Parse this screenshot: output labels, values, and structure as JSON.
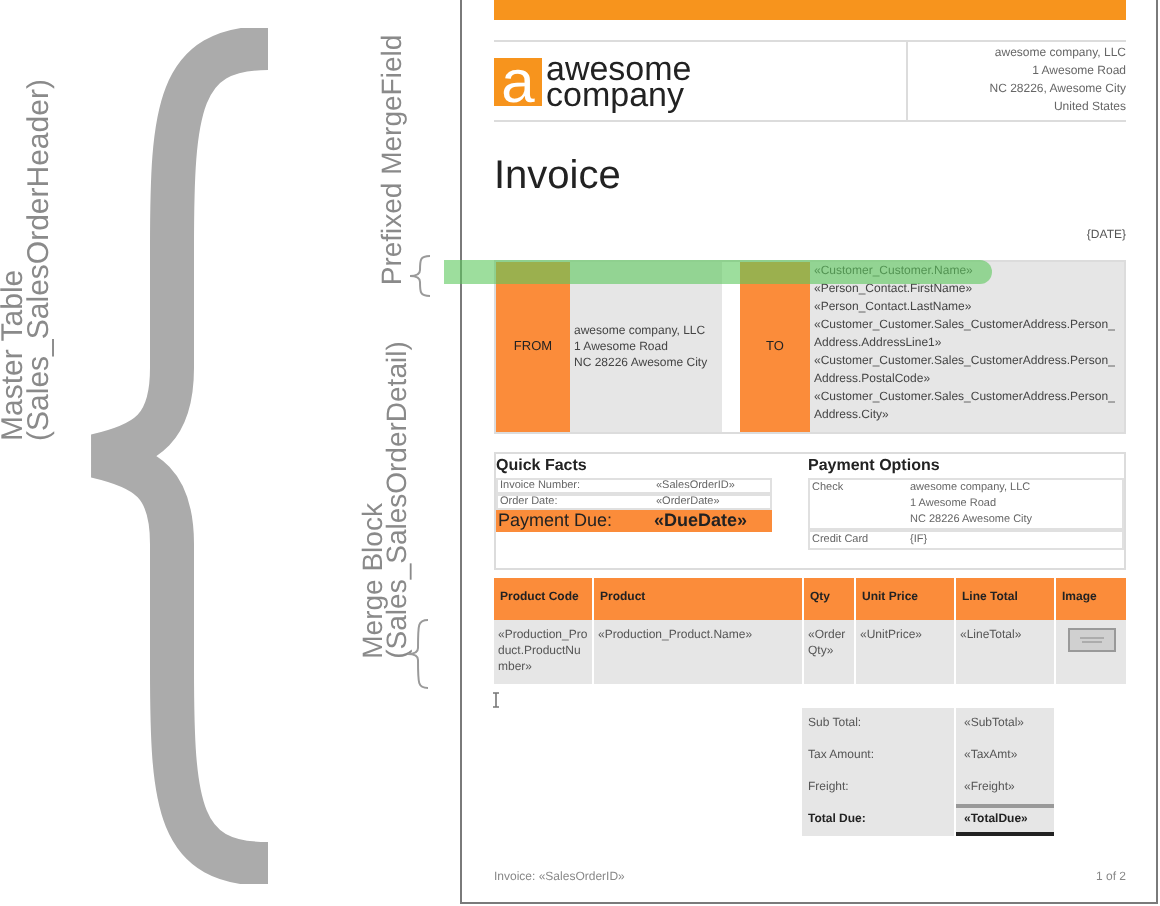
{
  "annotations": [
    {
      "lines": [
        "Master Table",
        "(Sales_SalesOrderHeader)"
      ],
      "kind": "large"
    },
    {
      "lines": [
        "Prefixed MergeField"
      ],
      "kind": "small"
    },
    {
      "lines": [
        "Merge Block",
        "(Sales_SalesOrderDetail)"
      ],
      "kind": "small"
    }
  ],
  "document": {
    "logo": {
      "letter": "a",
      "line1": "awesome",
      "line2": "company"
    },
    "company_address": [
      "awesome company, LLC",
      "1 Awesome Road",
      "NC 28226, Awesome City",
      "United States"
    ],
    "title": "Invoice",
    "date": "{DATE}",
    "from": {
      "label": "FROM",
      "lines": [
        "awesome company, LLC",
        "1 Awesome Road",
        "NC 28226 Awesome City"
      ]
    },
    "to": {
      "label": "TO",
      "lines": [
        {
          "text": "«Customer_Customer.Name»",
          "highlighted": true
        },
        {
          "text": "«Person_Contact.FirstName»",
          "highlighted": false
        },
        {
          "text": "«Person_Contact.LastName»",
          "highlighted": false
        },
        {
          "text": "«Customer_Customer.Sales_CustomerAddress.Person_",
          "highlighted": false
        },
        {
          "text": "Address.AddressLine1»",
          "highlighted": false
        },
        {
          "text": "«Customer_Customer.Sales_CustomerAddress.Person_",
          "highlighted": false
        },
        {
          "text": "Address.PostalCode»",
          "highlighted": false
        },
        {
          "text": "«Customer_Customer.Sales_CustomerAddress.Person_",
          "highlighted": false
        },
        {
          "text": "Address.City»",
          "highlighted": false
        }
      ]
    },
    "quick_facts": {
      "title": "Quick Facts",
      "rows": [
        {
          "label": "Invoice Number:",
          "value": "«SalesOrderID»",
          "kind": "plain"
        },
        {
          "label": "Order Date:",
          "value": "«OrderDate»",
          "kind": "plain"
        },
        {
          "label": "Payment Due:",
          "value": "«DueDate»",
          "kind": "emphasis"
        }
      ]
    },
    "payment_options": {
      "title": "Payment Options",
      "rows": [
        {
          "label": "Check",
          "lines": [
            "awesome company, LLC",
            "1 Awesome Road",
            "NC 28226 Awesome City"
          ]
        },
        {
          "label": "Credit Card",
          "lines": [
            "{IF}"
          ]
        }
      ]
    },
    "items": {
      "columns": [
        "Product Code",
        "Product",
        "Qty",
        "Unit Price",
        "Line Total",
        "Image"
      ],
      "row": [
        {
          "kind": "text",
          "text": "«Production_Product.ProductNumber»"
        },
        {
          "kind": "text",
          "text": "«Production_Product.Name»"
        },
        {
          "kind": "text",
          "text": "«OrderQty»"
        },
        {
          "kind": "text",
          "text": "«UnitPrice»"
        },
        {
          "kind": "text",
          "text": "«LineTotal»"
        },
        {
          "kind": "image"
        }
      ]
    },
    "totals": [
      {
        "label": "Sub Total:",
        "value": "«SubTotal»",
        "kind": "plain"
      },
      {
        "label": "Tax Amount:",
        "value": "«TaxAmt»",
        "kind": "plain"
      },
      {
        "label": "Freight:",
        "value": "«Freight»",
        "kind": "plain"
      },
      {
        "label": "Total Due:",
        "value": "«TotalDue»",
        "kind": "total"
      }
    ],
    "footer": {
      "left": "Invoice: «SalesOrderID»",
      "right": "1 of 2"
    }
  }
}
